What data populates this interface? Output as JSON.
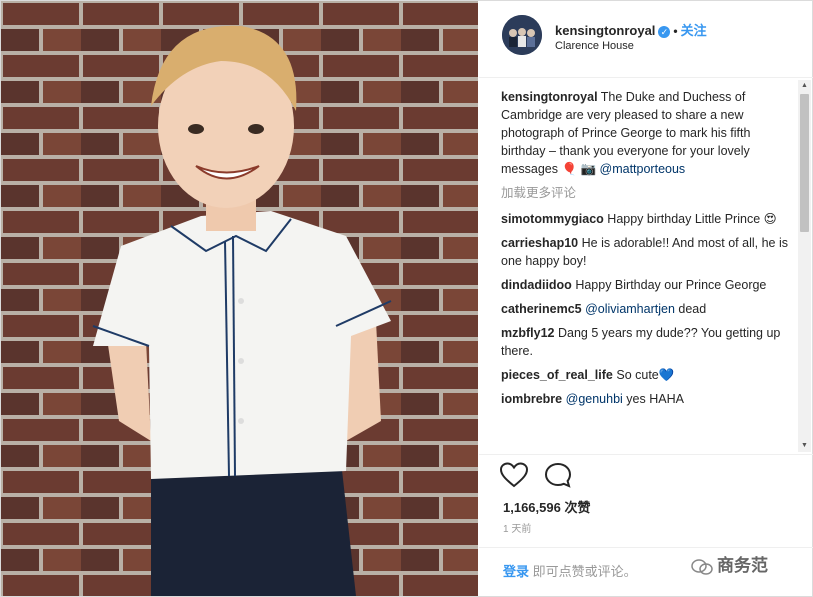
{
  "post": {
    "username": "kensingtonroyal",
    "follow_label": "关注",
    "location": "Clarence House"
  },
  "comments": [
    {
      "user": "kensingtonroyal",
      "text": "The Duke and Duchess of Cambridge are very pleased to share a new photograph of Prince George to mark his fifth birthday – thank you everyone for your lovely messages 🎈 📷 ",
      "mention": "@mattporteous"
    },
    {
      "user": "simotommygiaco",
      "text": "Happy birthday Little Prince 😍",
      "mention": ""
    },
    {
      "user": "carrieshap10",
      "text": "He is adorable!! And most of all, he is one happy boy!",
      "mention": ""
    },
    {
      "user": "dindadiidoo",
      "text": "Happy Birthday our Prince George",
      "mention": ""
    },
    {
      "user": "catherinemc5",
      "text": " dead",
      "mention": "@oliviamhartjen",
      "mention_first": true
    },
    {
      "user": "mzbfly12",
      "text": "Dang 5 years my dude?? You getting up there.",
      "mention": ""
    },
    {
      "user": "pieces_of_real_life",
      "text": "So cute💙",
      "mention": ""
    },
    {
      "user": "iombrebre",
      "text": " yes HAHA",
      "mention": "@genuhbi",
      "mention_first": true
    }
  ],
  "load_more_label": "加载更多评论",
  "likes_text": "1,166,596 次赞",
  "time_text": "1 天前",
  "login_link": "登录",
  "login_rest": " 即可点赞或评论。",
  "watermark": "商务范",
  "icons": [
    "heart-icon",
    "comment-icon",
    "verified-icon"
  ],
  "colors": {
    "link": "#3897f0",
    "mention": "#003569",
    "muted": "#999999"
  }
}
